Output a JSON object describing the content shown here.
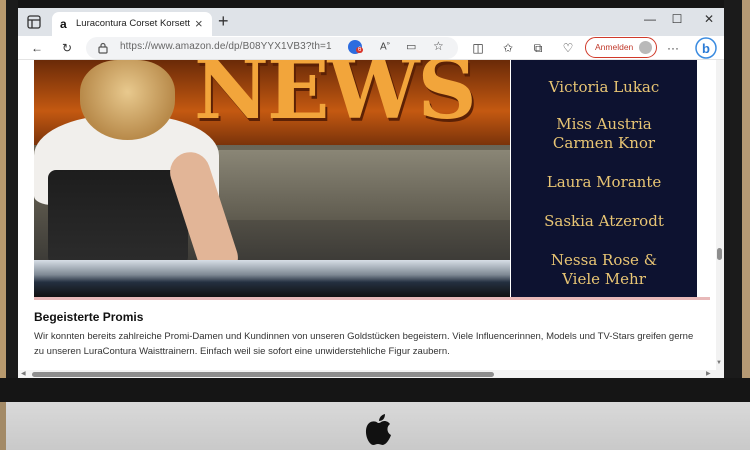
{
  "tab": {
    "title": "Luracontura Corset Korsett Damen",
    "favicon": "a"
  },
  "toolbar": {
    "url": "https://www.amazon.de/dp/B08YYX1VB3?th=1",
    "sign_in_label": "Anmelden",
    "extension_badge": "6"
  },
  "hero": {
    "banner_text": "NEWS",
    "names": [
      "Victoria Lukac",
      "Miss Austria",
      "Carmen Knor",
      "Laura Morante",
      "Saskia Atzerodt",
      "Nessa Rose &",
      "Viele Mehr"
    ]
  },
  "section": {
    "title": "Begeisterte Promis",
    "body": "Wir konnten bereits zahlreiche Promi-Damen und Kundinnen von unseren Goldstücken begeistern. Viele Influencerinnen, Models und TV-Stars greifen gerne zu unseren LuraContura Waisttrainern. Einfach weil sie sofort eine unwiderstehliche Figur zaubern."
  },
  "colors": {
    "accent_red": "#d03a2a",
    "names_gold": "#e8c574",
    "names_bg": "#0d1230"
  }
}
